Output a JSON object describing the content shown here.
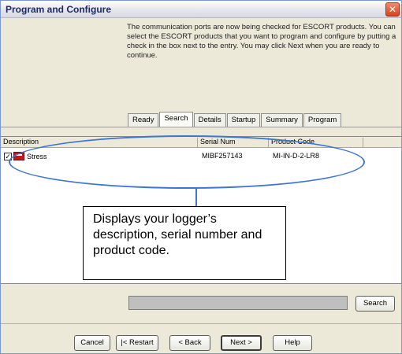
{
  "window": {
    "title": "Program and Configure",
    "close_glyph": "✕"
  },
  "intro_text": "The communication ports are now being checked for ESCORT products. You can select the ESCORT products that you want to program and configure by putting a check in the box next to the entry. You may click Next when you are ready to continue.",
  "tabs": [
    "Ready",
    "Search",
    "Details",
    "Startup",
    "Summary",
    "Program"
  ],
  "active_tab": "Search",
  "table": {
    "headers": [
      "Description",
      "Serial Num",
      "Product Code",
      ""
    ],
    "rows": [
      {
        "checked": true,
        "check_glyph": "✓",
        "description": "Stress",
        "serial": "MIBF257143",
        "product_code": "MI-IN-D-2-LR8"
      }
    ]
  },
  "callout_text": "Displays your logger’s description, serial number and product code.",
  "buttons": {
    "search": "Search",
    "cancel": "Cancel",
    "restart": "|< Restart",
    "back": "< Back",
    "next": "Next >",
    "help": "Help"
  },
  "colors": {
    "annotation_blue": "#3e74d4",
    "logger_red": "#c0181c"
  }
}
